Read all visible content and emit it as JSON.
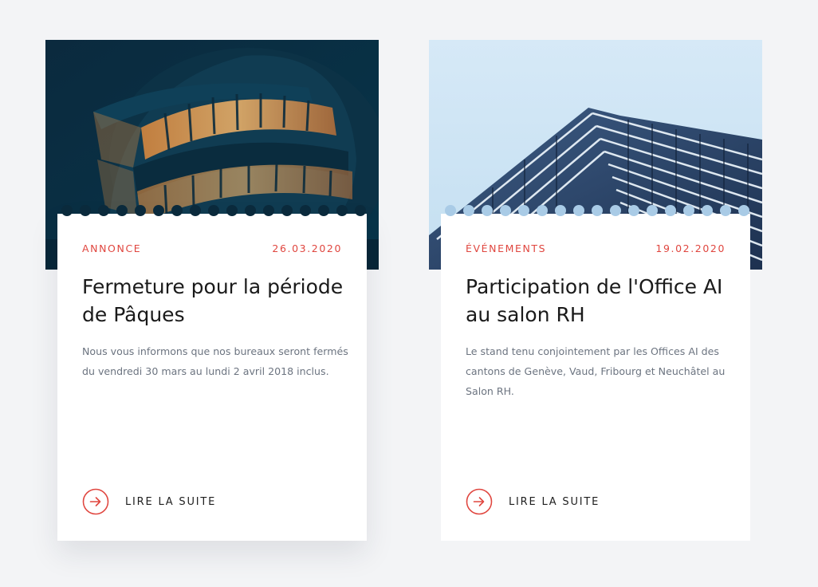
{
  "colors": {
    "background": "#f3f4f6",
    "accent": "#e0463f",
    "title": "#1a1a1a",
    "text": "#6c7480"
  },
  "cards": [
    {
      "image": "night-building-photo",
      "category": "ANNONCE",
      "date": "26.03.2020",
      "title": "Fermeture pour la période de Pâques",
      "excerpt": "Nous vous informons que nos bureaux seront fermés du vendredi 30 mars au lundi 2 avril 2018 inclus.",
      "link_label": "LIRE LA SUITE",
      "link_icon": "arrow-right-circle-icon"
    },
    {
      "image": "glass-tower-photo",
      "category": "ÉVÉNEMENTS",
      "date": "19.02.2020",
      "title": "Participation de l'Office AI au salon RH",
      "excerpt": "Le stand tenu conjointement par les Offices AI des cantons de Genève, Vaud, Fribourg et Neuchâtel au Salon RH.",
      "link_label": "LIRE LA SUITE",
      "link_icon": "arrow-right-circle-icon"
    }
  ]
}
